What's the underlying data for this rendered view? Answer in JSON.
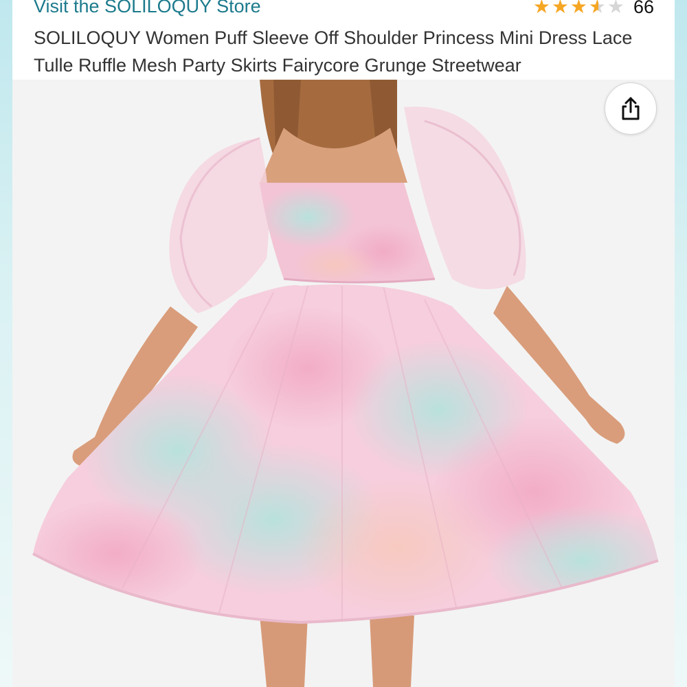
{
  "header": {
    "store_link": "Visit the SOLILOQUY Store",
    "rating": {
      "value": 3.5,
      "max": 5,
      "count": "66"
    },
    "title": "SOLILOQUY Women Puff Sleeve Off Shoulder Princess Mini Dress Lace Tulle Ruffle Mesh Party Skirts Fairycore Grunge Streetwear"
  },
  "icons": {
    "share": "share-icon",
    "star": "star-icon"
  },
  "colors": {
    "link": "#1c7a8c",
    "star": "#f5a623",
    "star_empty": "#d6d6d6",
    "dress_pink": "#f4b9cf",
    "dress_mint": "#bfe6e0"
  }
}
